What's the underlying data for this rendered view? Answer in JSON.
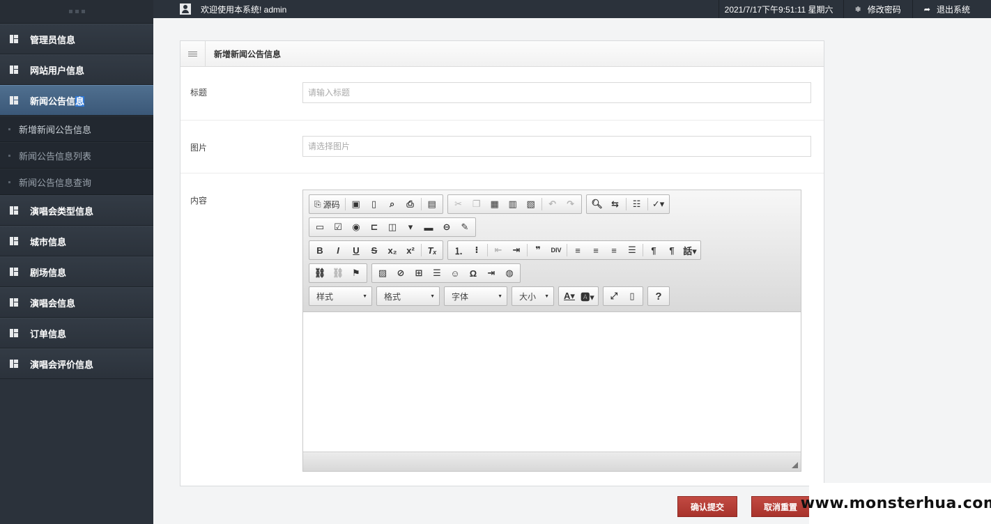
{
  "topbar": {
    "welcome": "欢迎使用本系统! admin",
    "datetime": "2021/7/17下午9:51:11 星期六",
    "change_password": "修改密码",
    "logout": "退出系统"
  },
  "sidebar": {
    "items": [
      {
        "label": "管理员信息"
      },
      {
        "label": "网站用户信息"
      },
      {
        "label_main": "新闻公告信",
        "label_sel": "息"
      },
      {
        "label": "演唱会类型信息"
      },
      {
        "label": "城市信息"
      },
      {
        "label": "剧场信息"
      },
      {
        "label": "演唱会信息"
      },
      {
        "label": "订单信息"
      },
      {
        "label": "演唱会评价信息"
      }
    ],
    "submenu": [
      {
        "label": "新增新闻公告信息"
      },
      {
        "label": "新闻公告信息列表"
      },
      {
        "label": "新闻公告信息查询"
      }
    ]
  },
  "panel": {
    "title": "新增新闻公告信息"
  },
  "form": {
    "title_label": "标题",
    "title_placeholder": "请输入标题",
    "title_value": "",
    "image_label": "图片",
    "image_placeholder": "请选择图片",
    "image_value": "",
    "content_label": "内容"
  },
  "editor": {
    "source_label": "源码",
    "combos": {
      "style": "样式",
      "format": "格式",
      "font": "字体",
      "size": "大小"
    },
    "content": ""
  },
  "buttons": {
    "submit": "确认提交",
    "reset": "取消重置"
  },
  "watermark": "www.monsterhua.com",
  "colors": {
    "sidebar_bg": "#2b323b",
    "sidebar_active": "#3b5878",
    "button_red": "#b33b33",
    "panel_border": "#d8dadc"
  }
}
